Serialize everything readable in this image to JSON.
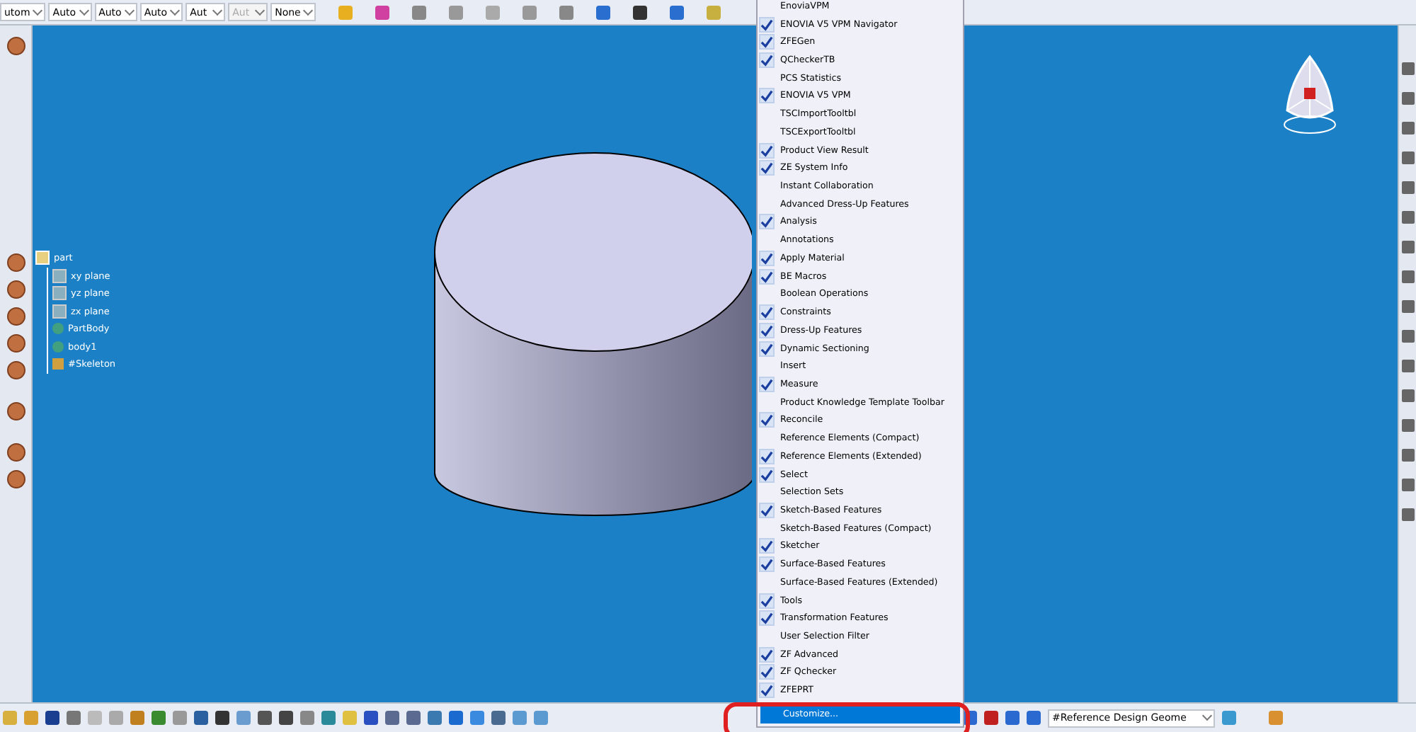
{
  "top_toolbar": {
    "dropdowns": [
      {
        "value": "utom",
        "disabled": false
      },
      {
        "value": "Auto",
        "disabled": false
      },
      {
        "value": "Auto",
        "disabled": false
      },
      {
        "value": "Auto",
        "disabled": false
      },
      {
        "value": "Aut",
        "disabled": false
      },
      {
        "value": "Aut",
        "disabled": true
      },
      {
        "value": "None",
        "disabled": false
      }
    ]
  },
  "tree": {
    "label": "part",
    "children": [
      {
        "label": "xy plane",
        "kind": "plane"
      },
      {
        "label": "yz plane",
        "kind": "plane"
      },
      {
        "label": "zx plane",
        "kind": "plane"
      },
      {
        "label": "PartBody",
        "kind": "body"
      },
      {
        "label": "body1",
        "kind": "body"
      },
      {
        "label": "#Skeleton",
        "kind": "skeleton"
      }
    ]
  },
  "toolbars_menu": {
    "items": [
      {
        "label": "EnoviaVPM",
        "checked": false
      },
      {
        "label": "ENOVIA V5 VPM Navigator",
        "checked": true
      },
      {
        "label": "ZFEGen",
        "checked": true
      },
      {
        "label": "QCheckerTB",
        "checked": true
      },
      {
        "label": "PCS Statistics",
        "checked": false
      },
      {
        "label": "ENOVIA V5 VPM",
        "checked": true
      },
      {
        "label": "TSCImportTooltbl",
        "checked": false
      },
      {
        "label": "TSCExportTooltbl",
        "checked": false
      },
      {
        "label": "Product View Result",
        "checked": true
      },
      {
        "label": "ZE System Info",
        "checked": true
      },
      {
        "label": "Instant Collaboration",
        "checked": false
      },
      {
        "label": "Advanced Dress-Up Features",
        "checked": false
      },
      {
        "label": "Analysis",
        "checked": true
      },
      {
        "label": "Annotations",
        "checked": false
      },
      {
        "label": "Apply Material",
        "checked": true
      },
      {
        "label": "BE Macros",
        "checked": true
      },
      {
        "label": "Boolean Operations",
        "checked": false
      },
      {
        "label": "Constraints",
        "checked": true
      },
      {
        "label": "Dress-Up Features",
        "checked": true
      },
      {
        "label": "Dynamic Sectioning",
        "checked": true
      },
      {
        "label": "Insert",
        "checked": false
      },
      {
        "label": "Measure",
        "checked": true
      },
      {
        "label": "Product Knowledge Template Toolbar",
        "checked": false
      },
      {
        "label": "Reconcile",
        "checked": true
      },
      {
        "label": "Reference Elements (Compact)",
        "checked": false
      },
      {
        "label": "Reference Elements (Extended)",
        "checked": true
      },
      {
        "label": "Select",
        "checked": true
      },
      {
        "label": "Selection Sets",
        "checked": false
      },
      {
        "label": "Sketch-Based Features",
        "checked": true
      },
      {
        "label": "Sketch-Based Features (Compact)",
        "checked": false
      },
      {
        "label": "Sketcher",
        "checked": true
      },
      {
        "label": "Surface-Based Features",
        "checked": true
      },
      {
        "label": "Surface-Based Features (Extended)",
        "checked": false
      },
      {
        "label": "Tools",
        "checked": true
      },
      {
        "label": "Transformation Features",
        "checked": true
      },
      {
        "label": "User Selection Filter",
        "checked": false
      },
      {
        "label": "ZF Advanced",
        "checked": true
      },
      {
        "label": "ZF Qchecker",
        "checked": true
      },
      {
        "label": "ZFEPRT",
        "checked": true
      }
    ],
    "customize": {
      "label": "Customize...",
      "selected": true
    }
  },
  "bottom_toolbar": {
    "filter_dropdown": {
      "value": "#Reference Design Geome"
    }
  }
}
